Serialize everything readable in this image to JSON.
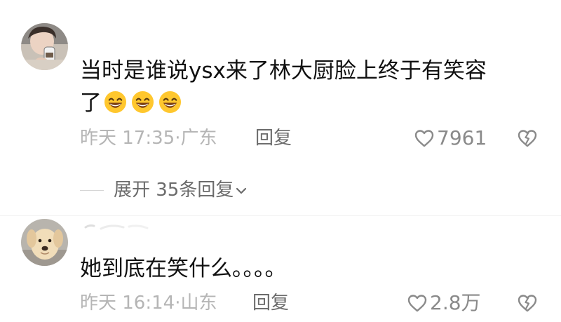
{
  "comments": [
    {
      "text_line_1": "当时是谁说ysx来了林大厨脸上终于有笑容",
      "text_line_2": "了",
      "emojis": [
        "grinning-face-emoji",
        "grinning-face-emoji",
        "grinning-face-emoji"
      ],
      "time_location": "昨天 17:35·广东",
      "reply_label": "回复",
      "like_count": "7961"
    },
    {
      "text": "她到底在笑什么。。。。",
      "time_location": "昨天 16:14·山东",
      "reply_label": "回复",
      "like_count": "2.8万"
    }
  ],
  "expand_replies": {
    "label": "展开 35条回复"
  },
  "colors": {
    "text_primary": "#111111",
    "text_secondary": "#b5b5b5",
    "text_action": "#6b6b6b",
    "emoji_yellow": "#ffc72e"
  }
}
